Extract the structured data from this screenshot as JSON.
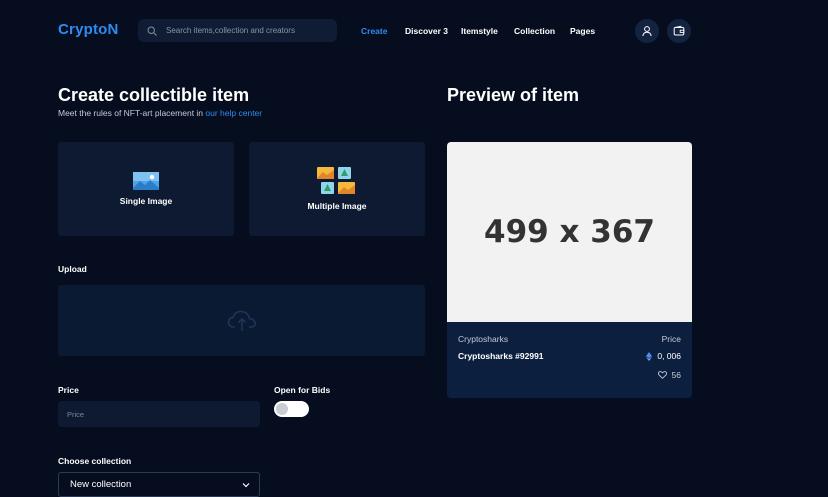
{
  "header": {
    "logo": "CryptoN",
    "search_placeholder": "Search items,collection and creators",
    "nav": [
      {
        "label": "Create",
        "active": true
      },
      {
        "label": "Discover 3",
        "active": false
      },
      {
        "label": "Itemstyle",
        "active": false
      },
      {
        "label": "Collection",
        "active": false
      },
      {
        "label": "Pages",
        "active": false
      }
    ],
    "icons": [
      "user-icon",
      "wallet-icon"
    ]
  },
  "create": {
    "title": "Create collectible item",
    "subtitle_prefix": "Meet the rules of NFT-art placement in",
    "subtitle_link": "our help center",
    "types": [
      {
        "label": "Single Image",
        "icon": "single-image-icon"
      },
      {
        "label": "Multiple Image",
        "icon": "multiple-image-icon"
      }
    ],
    "upload_label": "Upload",
    "upload_icon": "cloud-upload-icon",
    "price_label": "Price",
    "price_placeholder": "Price",
    "bids_label": "Open for Bids",
    "bids_enabled": false,
    "collection_label": "Choose collection",
    "collection_value": "New collection"
  },
  "preview": {
    "title": "Preview of item",
    "placeholder_text": "499 x 367",
    "collection": "Cryptosharks",
    "price_label": "Price",
    "item_name": "Cryptosharks #92991",
    "price_value": "0, 006",
    "likes": "56",
    "currency_icon": "ethereum-icon",
    "like_icon": "heart-icon"
  },
  "colors": {
    "background": "#060d1f",
    "accent": "#2e8cf0",
    "card": "#0d1a32"
  }
}
